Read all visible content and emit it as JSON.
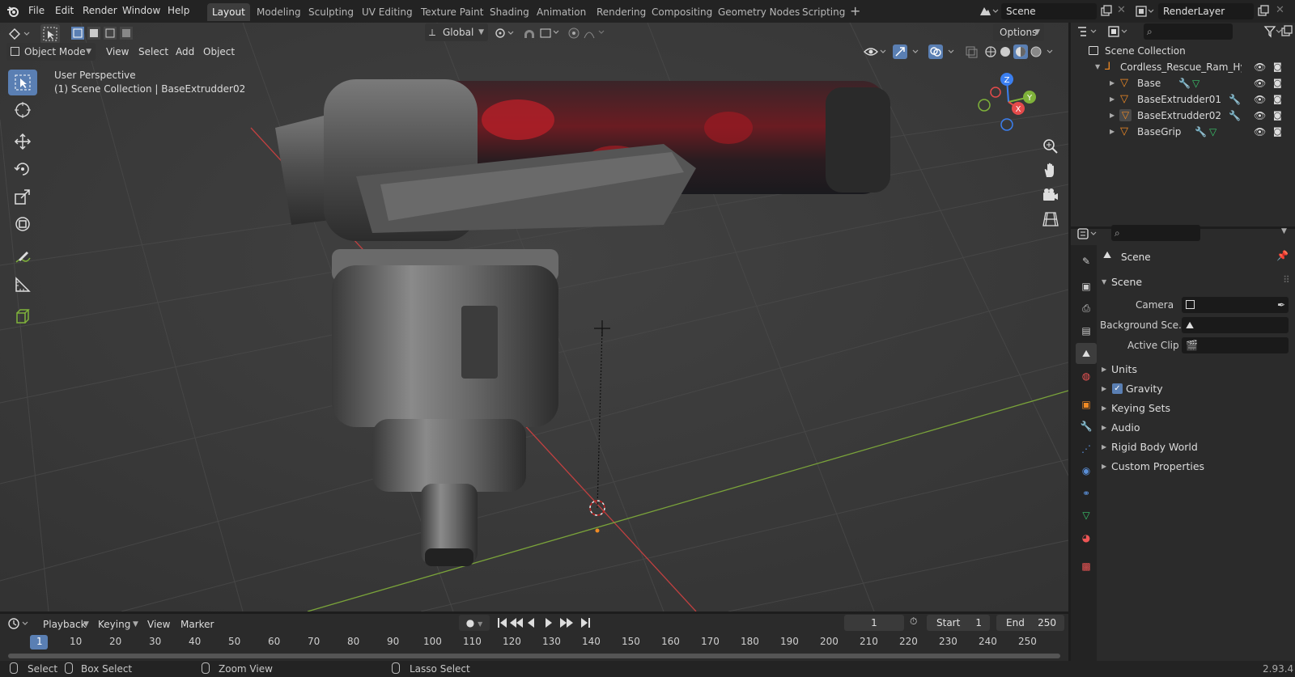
{
  "menus": [
    "File",
    "Edit",
    "Render",
    "Window",
    "Help"
  ],
  "workspaces": [
    "Layout",
    "Modeling",
    "Sculpting",
    "UV Editing",
    "Texture Paint",
    "Shading",
    "Animation",
    "Rendering",
    "Compositing",
    "Geometry Nodes",
    "Scripting"
  ],
  "scene_name": "Scene",
  "view_layer": "RenderLayer",
  "viewport": {
    "transform_orientation": "Global",
    "options_label": "Options",
    "mode": "Object Mode",
    "header_menus": [
      "View",
      "Select",
      "Add",
      "Object"
    ],
    "overlay_line1": "User Perspective",
    "overlay_line2": "(1) Scene Collection | BaseExtrudder02",
    "gizmo": {
      "x": "X",
      "y": "Y",
      "z": "Z"
    }
  },
  "outliner": {
    "root": "Scene Collection",
    "collection": "Cordless_Rescue_Ram_Hydra",
    "items": [
      "Base",
      "BaseExtrudder01",
      "BaseExtrudder02",
      "BaseGrip"
    ]
  },
  "properties": {
    "context": "Scene",
    "panel": "Scene",
    "fields": [
      {
        "label": "Camera",
        "value": ""
      },
      {
        "label": "Background Sce...",
        "value": ""
      },
      {
        "label": "Active Clip",
        "value": ""
      }
    ],
    "sections": [
      "Units",
      "Gravity",
      "Keying Sets",
      "Audio",
      "Rigid Body World",
      "Custom Properties"
    ],
    "gravity_enabled": true
  },
  "timeline": {
    "menus": [
      "Playback",
      "Keying",
      "View",
      "Marker"
    ],
    "current_frame": "1",
    "start_label": "Start",
    "start": "1",
    "end_label": "End",
    "end": "250",
    "ticks": [
      "1",
      "10",
      "20",
      "30",
      "40",
      "50",
      "60",
      "70",
      "80",
      "90",
      "100",
      "110",
      "120",
      "130",
      "140",
      "150",
      "160",
      "170",
      "180",
      "190",
      "200",
      "210",
      "220",
      "230",
      "240",
      "250"
    ]
  },
  "status": {
    "select": "Select",
    "box_select": "Box Select",
    "zoom_view": "Zoom View",
    "lasso_select": "Lasso Select",
    "version": "2.93.4"
  },
  "colors": {
    "accent": "#5a7fb3",
    "x_axis": "#e54b4b",
    "y_axis": "#7fb23a",
    "z_axis": "#3b7ff0",
    "object_orange": "#f08a24"
  }
}
